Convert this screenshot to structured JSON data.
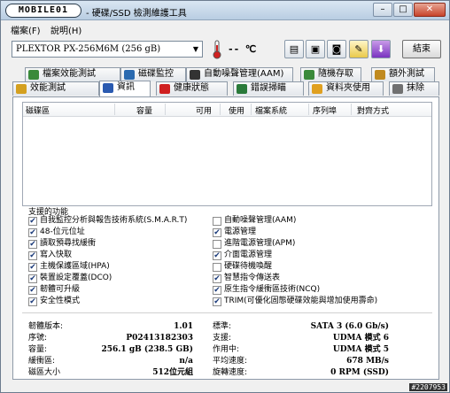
{
  "window": {
    "logo_text": "MOBILE01",
    "title": "- 硬碟/SSD 檢測維護工具",
    "minimize_label": "–",
    "maximize_label": "□",
    "close_label": "✕"
  },
  "menu": [
    {
      "label": "檔案(F)"
    },
    {
      "label": "說明(H)"
    }
  ],
  "toolbar": {
    "drive": "PLEXTOR PX-256M6M (256 gB)",
    "temperature": "-- ℃",
    "exit_label": "結束"
  },
  "tabs_row1": [
    {
      "label": "檔案效能測試",
      "icon": "file-speed-icon",
      "color": "#3a8a3a"
    },
    {
      "label": "磁碟監控",
      "icon": "disk-monitor-icon",
      "color": "#2a6ab0"
    },
    {
      "label": "自動噪聲管理(AAM)",
      "icon": "speaker-icon",
      "color": "#333333"
    },
    {
      "label": "隨機存取",
      "icon": "random-access-icon",
      "color": "#3a8a3a"
    },
    {
      "label": "額外測試",
      "icon": "extra-test-icon",
      "color": "#c08a20"
    }
  ],
  "tabs_row2": [
    {
      "label": "效能測試",
      "icon": "benchmark-icon",
      "color": "#d4a020"
    },
    {
      "label": "資訊",
      "icon": "info-icon",
      "color": "#2a5ab0"
    },
    {
      "label": "健康狀態",
      "icon": "health-cross-icon",
      "color": "#d02020"
    },
    {
      "label": "錯誤掃瞄",
      "icon": "magnifier-icon",
      "color": "#2a7a3a"
    },
    {
      "label": "資料夾使用",
      "icon": "folder-icon",
      "color": "#e0a020"
    },
    {
      "label": "抹除",
      "icon": "trash-icon",
      "color": "#707070"
    }
  ],
  "partition_table": {
    "columns": [
      "磁碟區",
      "容量",
      "可用",
      "使用",
      "檔案系統",
      "序列埠",
      "對齊方式"
    ]
  },
  "features_title": "支援的功能",
  "features_left": [
    {
      "label": "自我監控分析與報告技術系統(S.M.A.R.T)",
      "checked": true
    },
    {
      "label": "48-位元位址",
      "checked": true
    },
    {
      "label": "讀取預尋找緩衝",
      "checked": true
    },
    {
      "label": "寫入快取",
      "checked": true
    },
    {
      "label": "主機保護區域(HPA)",
      "checked": true
    },
    {
      "label": "裝置設定覆蓋(DCO)",
      "checked": true
    },
    {
      "label": "韌體可升級",
      "checked": true
    },
    {
      "label": "安全性模式",
      "checked": true
    }
  ],
  "features_right": [
    {
      "label": "自動噪聲管理(AAM)",
      "checked": false
    },
    {
      "label": "電源管理",
      "checked": true
    },
    {
      "label": "進階電源管理(APM)",
      "checked": false
    },
    {
      "label": "介面電源管理",
      "checked": true
    },
    {
      "label": "硬碟待機喚醒",
      "checked": false
    },
    {
      "label": "智慧指令傳送表",
      "checked": true
    },
    {
      "label": "原生指令緩衝區技術(NCQ)",
      "checked": true
    },
    {
      "label": "TRIM(可優化固態硬碟效能與增加使用壽命)",
      "checked": true
    }
  ],
  "info_left": [
    {
      "label": "韌體版本:",
      "value": "1.01"
    },
    {
      "label": "序號:",
      "value": "P02413182303"
    },
    {
      "label": "容量:",
      "value": "256.1 gB (238.5 GB)"
    },
    {
      "label": "緩衝區:",
      "value": "n/a"
    },
    {
      "label": "磁區大小",
      "value": "512位元組"
    }
  ],
  "info_right": [
    {
      "label": "標準:",
      "value": "SATA 3 (6.0 Gb/s)"
    },
    {
      "label": "支援:",
      "value": "UDMA 模式 6"
    },
    {
      "label": "作用中:",
      "value": "UDMA 模式 5"
    },
    {
      "label": "平均速度:",
      "value": "678 MB/s"
    },
    {
      "label": "旋轉速度:",
      "value": "0 RPM (SSD)"
    }
  ],
  "watermark": "#2207953"
}
